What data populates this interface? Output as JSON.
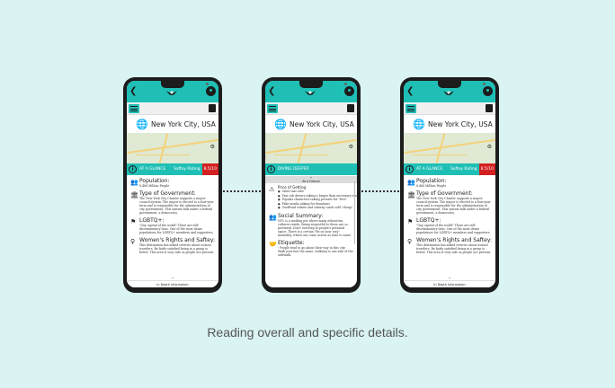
{
  "caption": "Reading overall and specific details.",
  "colors": {
    "accent": "#1fbfb5",
    "danger": "#d32020",
    "background": "#daf3f3"
  },
  "phone_left": {
    "city": "New York City, USA",
    "glance_label": "AT A GLANCE",
    "safety_label": "Saftey Rating",
    "safety_value": "8.5/10",
    "sections": [
      {
        "icon": "people-icon",
        "title": "Population:",
        "text": "8.468 Million People"
      },
      {
        "icon": "government-icon",
        "title": "Type of Government:",
        "text": "The New York City Charter supports a mayor-council system. The mayor is elected to a four-year term and is responsible for the administration of city government. This system falls under a federal government, a democracy."
      },
      {
        "icon": "lgbtq-icon",
        "title": "LGBTQ+:",
        "text": "\"Gay capital of the world\" There are still discriminatory laws. One of the most dense populations for LGBTQ+ members and supporters."
      },
      {
        "icon": "women-icon",
        "title": "Women's Rights and Saftey:",
        "text": "This destination has mixed reviews about women travelers. Be fairly satisfied being in a group is better. This area is very safe as people are present."
      }
    ],
    "bottom_link": "In Depth Information"
  },
  "phone_middle": {
    "city": "New York City, USA",
    "glance_label": "DIVING DEEPER",
    "at_a_glance": "At a Glance",
    "first_heading": "Price of Getting",
    "bullets": [
      "Value taxi cabs",
      "Taxi cab drivers taking a longer than necessary route to add on minutes",
      "Popular characters taking pictures for \"free\"",
      "Fake monks asking for donations",
      "Unofficial tickets and subway cards sold \"cheap\""
    ],
    "social_title": "Social Summary:",
    "social_text": "NYC is a melting pot where many ethnicities, cultures reside. Being respectful to these are so pertinent. Don't overstep in people's personal space. There is a certain \"Be on your way\" mentality, which can come across as rude to some.",
    "etiquette_title": "Etiquette:",
    "etiquette_text": "- People tend to go about their way in this city. Walk your feet the same, walkway is one side of the sidewalk."
  },
  "phone_right": {
    "city": "New York City, USA",
    "glance_label": "AT A GLANCE",
    "safety_label": "Saftey Rating",
    "safety_value": "8.5/10",
    "sections": [
      {
        "icon": "people-icon",
        "title": "Population:",
        "text": "8.468 Million People"
      },
      {
        "icon": "government-icon",
        "title": "Type of Government:",
        "text": "The New York City Charter supports a mayor-council system. The mayor is elected to a four-year term and is responsible for the administration of city government. This system falls under a federal government, a democracy."
      },
      {
        "icon": "lgbtq-icon",
        "title": "LGBTQ+:",
        "text": "\"Gay capital of the world\" There are still discriminatory laws. One of the most dense populations for LGBTQ+ members and supporters."
      },
      {
        "icon": "women-icon",
        "title": "Women's Rights and Saftey:",
        "text": "This destination has mixed reviews about women travelers. Be fairly satisfied being in a group is better. This area is very safe as people are present."
      }
    ],
    "bottom_link": "In Depth Information"
  }
}
